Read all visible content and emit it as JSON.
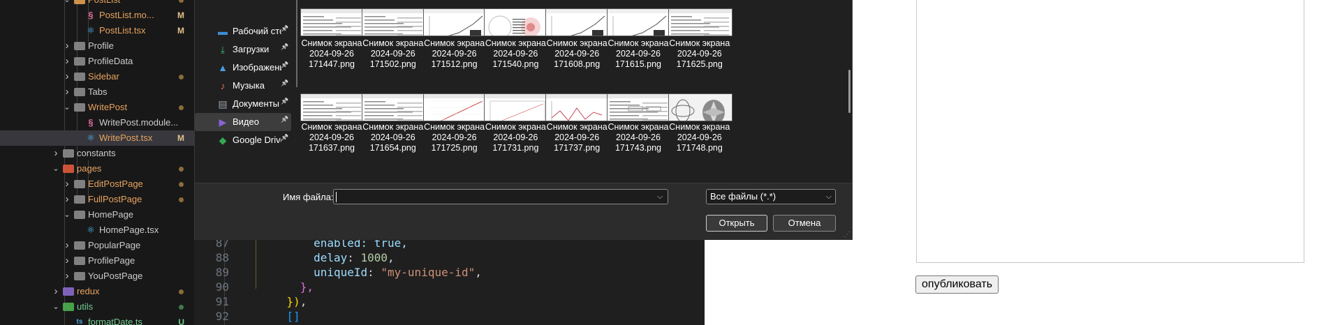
{
  "explorer": {
    "items": [
      {
        "label": "PostList",
        "kind": "folder",
        "open": true,
        "depth": 3,
        "color": "#e8a35f",
        "status": "dot",
        "status_color": "#8a6d3b",
        "folder_color": "#e0a050"
      },
      {
        "label": "PostList.mo...",
        "kind": "sass",
        "depth": 4,
        "color": "#e8a35f",
        "status": "M",
        "status_color": "#e2c08d"
      },
      {
        "label": "PostList.tsx",
        "kind": "react",
        "depth": 4,
        "color": "#e8a35f",
        "status": "M",
        "status_color": "#e2c08d"
      },
      {
        "label": "Profile",
        "kind": "folder",
        "open": false,
        "depth": 3,
        "color": "#cccccc",
        "folder_color": "#8c8c8c"
      },
      {
        "label": "ProfileData",
        "kind": "folder",
        "open": false,
        "depth": 3,
        "color": "#cccccc",
        "folder_color": "#8c8c8c"
      },
      {
        "label": "Sidebar",
        "kind": "folder",
        "open": false,
        "depth": 3,
        "color": "#e8a35f",
        "status": "dot",
        "status_color": "#8a6d3b",
        "folder_color": "#8c8c8c"
      },
      {
        "label": "Tabs",
        "kind": "folder",
        "open": false,
        "depth": 3,
        "color": "#cccccc",
        "folder_color": "#8c8c8c"
      },
      {
        "label": "WritePost",
        "kind": "folder",
        "open": true,
        "depth": 3,
        "color": "#e8a35f",
        "status": "dot",
        "status_color": "#8a6d3b",
        "folder_color": "#8c8c8c"
      },
      {
        "label": "WritePost.module...",
        "kind": "sass",
        "depth": 4,
        "color": "#cccccc"
      },
      {
        "label": "WritePost.tsx",
        "kind": "react",
        "depth": 4,
        "color": "#e8a35f",
        "status": "M",
        "status_color": "#e2c08d",
        "selected": true
      },
      {
        "label": "constants",
        "kind": "folder",
        "open": false,
        "depth": 2,
        "color": "#cccccc",
        "folder_color": "#8c8c8c"
      },
      {
        "label": "pages",
        "kind": "folder",
        "open": true,
        "depth": 2,
        "color": "#e8a35f",
        "status": "dot",
        "status_color": "#8a6d3b",
        "folder_color": "#e05a3c"
      },
      {
        "label": "EditPostPage",
        "kind": "folder",
        "open": false,
        "depth": 3,
        "color": "#e8a35f",
        "status": "dot",
        "status_color": "#8a6d3b",
        "folder_color": "#8c8c8c"
      },
      {
        "label": "FullPostPage",
        "kind": "folder",
        "open": false,
        "depth": 3,
        "color": "#e8a35f",
        "status": "dot",
        "status_color": "#8a6d3b",
        "folder_color": "#8c8c8c"
      },
      {
        "label": "HomePage",
        "kind": "folder",
        "open": true,
        "depth": 3,
        "color": "#cccccc",
        "folder_color": "#8c8c8c"
      },
      {
        "label": "HomePage.tsx",
        "kind": "react",
        "depth": 4,
        "color": "#cccccc"
      },
      {
        "label": "PopularPage",
        "kind": "folder",
        "open": false,
        "depth": 3,
        "color": "#cccccc",
        "folder_color": "#8c8c8c"
      },
      {
        "label": "ProfilePage",
        "kind": "folder",
        "open": false,
        "depth": 3,
        "color": "#cccccc",
        "folder_color": "#8c8c8c"
      },
      {
        "label": "YouPostPage",
        "kind": "folder",
        "open": false,
        "depth": 3,
        "color": "#cccccc",
        "folder_color": "#8c8c8c"
      },
      {
        "label": "redux",
        "kind": "folder",
        "open": false,
        "depth": 2,
        "color": "#e8a35f",
        "status": "dot",
        "status_color": "#8a6d3b",
        "folder_color": "#8a6acb"
      },
      {
        "label": "utils",
        "kind": "folder",
        "open": true,
        "depth": 2,
        "color": "#73c991",
        "status": "dot",
        "status_color": "#3f7a4e",
        "folder_color": "#4caf50"
      },
      {
        "label": "formatDate.ts",
        "kind": "ts",
        "depth": 3,
        "color": "#73c991",
        "status": "U",
        "status_color": "#73c991"
      }
    ]
  },
  "editor": {
    "lines": [
      {
        "num": "87",
        "parts": [
          {
            "t": "        enabled: true,",
            "c": "#9cdcfe"
          }
        ]
      },
      {
        "num": "88",
        "parts": [
          {
            "t": "        ",
            "c": "#d4d4d4"
          },
          {
            "t": "delay",
            "c": "#9cdcfe"
          },
          {
            "t": ": ",
            "c": "#d4d4d4"
          },
          {
            "t": "1000",
            "c": "#b5cea8"
          },
          {
            "t": ",",
            "c": "#d4d4d4"
          }
        ]
      },
      {
        "num": "89",
        "parts": [
          {
            "t": "        ",
            "c": "#d4d4d4"
          },
          {
            "t": "uniqueId",
            "c": "#9cdcfe"
          },
          {
            "t": ": ",
            "c": "#d4d4d4"
          },
          {
            "t": "\"my-unique-id\"",
            "c": "#ce9178"
          },
          {
            "t": ",",
            "c": "#d4d4d4"
          }
        ]
      },
      {
        "num": "90",
        "parts": [
          {
            "t": "      ",
            "c": "#d4d4d4"
          },
          {
            "t": "},",
            "c": "#da70d6"
          }
        ]
      },
      {
        "num": "91",
        "parts": [
          {
            "t": "    ",
            "c": "#d4d4d4"
          },
          {
            "t": "})",
            "c": "#ffd700"
          },
          {
            "t": ",",
            "c": "#d4d4d4"
          }
        ]
      },
      {
        "num": "92",
        "parts": [
          {
            "t": "    ",
            "c": "#d4d4d4"
          },
          {
            "t": "[]",
            "c": "#179fff"
          }
        ]
      }
    ]
  },
  "dialog": {
    "nav": [
      {
        "label": "Рабочий стол",
        "icon": "desktop-icon",
        "color": "#3a8fd6",
        "pinned": true
      },
      {
        "label": "Загрузки",
        "icon": "download-icon",
        "color": "#3cb371",
        "pinned": true
      },
      {
        "label": "Изображения",
        "icon": "pictures-icon",
        "color": "#4a9ee8",
        "pinned": true
      },
      {
        "label": "Музыка",
        "icon": "music-icon",
        "color": "#e06a5a",
        "pinned": true
      },
      {
        "label": "Документы",
        "icon": "documents-icon",
        "color": "#9aa6b2",
        "pinned": true
      },
      {
        "label": "Видео",
        "icon": "video-icon",
        "color": "#8a63d2",
        "pinned": true,
        "active": true
      },
      {
        "label": "Google Drive",
        "icon": "google-drive-icon",
        "color": "#34a853",
        "pinned": true
      }
    ],
    "files": [
      {
        "line1": "Снимок экрана",
        "line2": "2024-09-26",
        "line3": "171447.png",
        "thumb": "table"
      },
      {
        "line1": "Снимок экрана",
        "line2": "2024-09-26",
        "line3": "171502.png",
        "thumb": "table"
      },
      {
        "line1": "Снимок экрана",
        "line2": "2024-09-26",
        "line3": "171512.png",
        "thumb": "plot"
      },
      {
        "line1": "Снимок экрана",
        "line2": "2024-09-26",
        "line3": "171540.png",
        "thumb": "circle"
      },
      {
        "line1": "Снимок экрана",
        "line2": "2024-09-26",
        "line3": "171608.png",
        "thumb": "plot"
      },
      {
        "line1": "Снимок экрана",
        "line2": "2024-09-26",
        "line3": "171615.png",
        "thumb": "plot"
      },
      {
        "line1": "Снимок экрана",
        "line2": "2024-09-26",
        "line3": "171625.png",
        "thumb": "table"
      },
      {
        "line1": "Снимок экрана",
        "line2": "2024-09-26",
        "line3": "171637.png",
        "thumb": "table"
      },
      {
        "line1": "Снимок экрана",
        "line2": "2024-09-26",
        "line3": "171654.png",
        "thumb": "table"
      },
      {
        "line1": "Снимок экрана",
        "line2": "2024-09-26",
        "line3": "171725.png",
        "thumb": "redline"
      },
      {
        "line1": "Снимок экрана",
        "line2": "2024-09-26",
        "line3": "171731.png",
        "thumb": "empty"
      },
      {
        "line1": "Снимок экрана",
        "line2": "2024-09-26",
        "line3": "171737.png",
        "thumb": "wave"
      },
      {
        "line1": "Снимок экрана",
        "line2": "2024-09-26",
        "line3": "171743.png",
        "thumb": "form"
      },
      {
        "line1": "Снимок экрана",
        "line2": "2024-09-26",
        "line3": "171748.png",
        "thumb": "petals"
      }
    ],
    "filename_label": "Имя файла:",
    "filename_value": "",
    "filter_label": "Все файлы (*.*)",
    "open_label": "Открыть",
    "cancel_label": "Отмена"
  },
  "page": {
    "publish_label": "опубликовать"
  }
}
